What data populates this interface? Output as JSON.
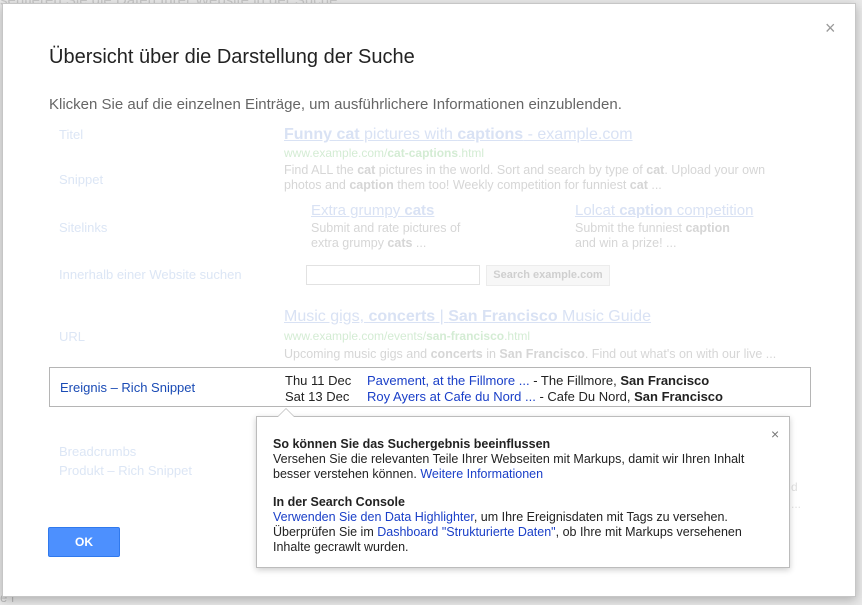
{
  "background": {
    "top_text": "sentieren Sie die Daten Ihrer Website in der Suche",
    "footer_text": "e f"
  },
  "dialog": {
    "title": "Übersicht über die Darstellung der Suche",
    "subtitle": "Klicken Sie auf die einzelnen Einträge, um ausführlichere Informationen einzublenden.",
    "close_label": "×",
    "ok_label": "OK"
  },
  "labels": {
    "titel": "Titel",
    "snippet": "Snippet",
    "sitelinks": "Sitelinks",
    "site_search": "Innerhalb einer Website suchen",
    "url": "URL",
    "event": "Ereignis – Rich Snippet",
    "breadcrumbs": "Breadcrumbs",
    "product": "Produkt – Rich Snippet"
  },
  "result1": {
    "title_parts": [
      "Funny ",
      "cat",
      " pictures with ",
      "captions",
      " - example.com"
    ],
    "url_parts": [
      "www.example.com/",
      "cat-captions",
      ".html"
    ],
    "snippet_line1": [
      "Find ALL the ",
      "cat",
      " pictures in the world. Sort and search by type of ",
      "cat",
      ". Upload your own"
    ],
    "snippet_line2": [
      "photos and ",
      "caption",
      " them too! Weekly competition for funniest ",
      "cat",
      " ..."
    ]
  },
  "sitelinks": {
    "left_title": [
      "Extra grumpy ",
      "cats"
    ],
    "left_line1": "Submit and rate pictures of",
    "left_line2": [
      "extra grumpy ",
      "cats",
      " ..."
    ],
    "right_title": [
      "Lolcat ",
      "caption",
      " competition"
    ],
    "right_line1": [
      "Submit the funniest ",
      "caption"
    ],
    "right_line2": "and win a prize! ..."
  },
  "site_search": {
    "button_label": "Search example.com"
  },
  "result2": {
    "title_parts": [
      "Music gigs, ",
      "concerts",
      " | ",
      "San Francisco",
      " Music Guide"
    ],
    "url_parts": [
      "www.example.com/events/",
      "san-francisco",
      ".html"
    ],
    "snippet": [
      "Upcoming music gigs and ",
      "concerts",
      " in ",
      "San Francisco",
      ". Find out what's on with our live ..."
    ]
  },
  "events": [
    {
      "date": "Thu 11 Dec",
      "link": "Pavement, at the Fillmore ...",
      "venue": " - The Fillmore, ",
      "city": "San Francisco"
    },
    {
      "date": "Sat 13 Dec",
      "link": "Roy Ayers at Cafe du Nord ...",
      "venue": " - Cafe Du Nord, ",
      "city": "San Francisco"
    }
  ],
  "popup": {
    "close_label": "×",
    "heading1": "So können Sie das Suchergebnis beeinflussen",
    "text1": "Versehen Sie die relevanten Teile Ihrer Webseiten mit Markups, damit wir Ihren Inhalt besser verstehen können. ",
    "link1": "Weitere Informationen",
    "heading2": "In der Search Console",
    "link2": "Verwenden Sie den Data Highlighter",
    "text2": ", um Ihre Ereignisdaten mit Tags zu versehen.",
    "text3": "Überprüfen Sie im ",
    "link3": "Dashboard \"Strukturierte Daten\"",
    "text4": ", ob Ihre mit Markups versehenen Inhalte gecrawlt wurden."
  },
  "under_popup": {
    "line1": "d",
    "line2": "..."
  }
}
